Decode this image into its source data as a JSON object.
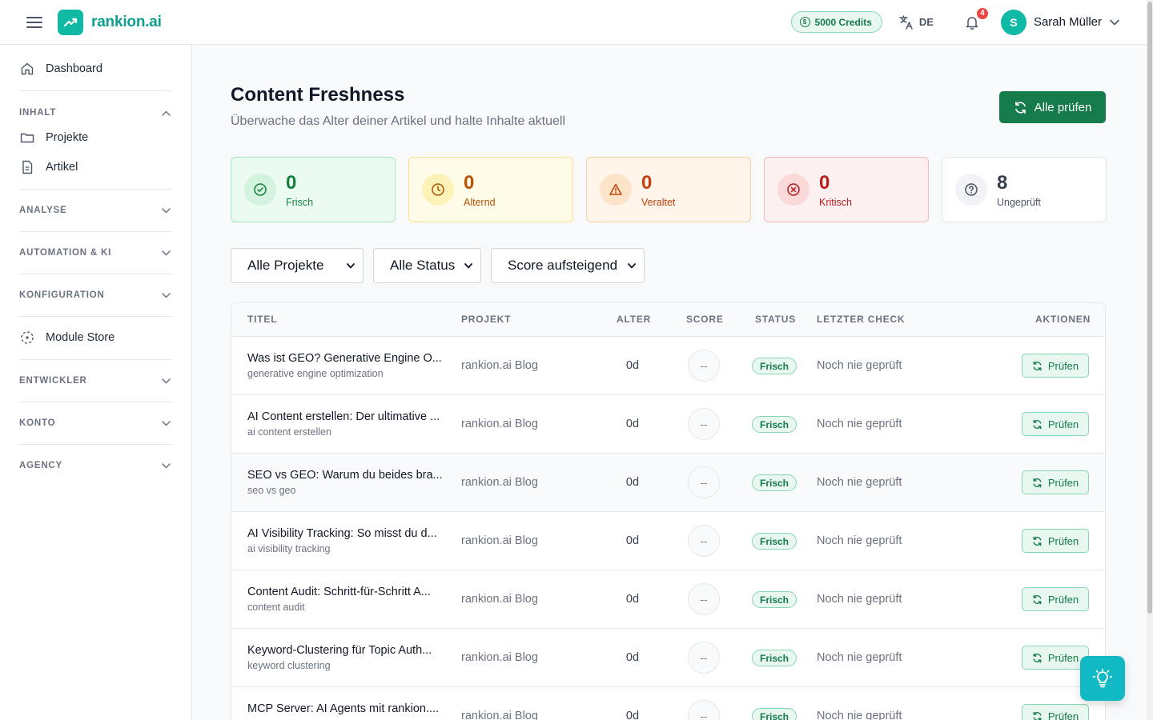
{
  "app": {
    "name": "rankion.ai"
  },
  "topbar": {
    "credits": "5000 Credits",
    "language": "DE",
    "notifications_count": "4",
    "user_initial": "S",
    "user_name": "Sarah Müller"
  },
  "sidebar": {
    "dashboard": "Dashboard",
    "inhalt": "INHALT",
    "projekte": "Projekte",
    "artikel": "Artikel",
    "analyse": "ANALYSE",
    "automation": "AUTOMATION & KI",
    "konfiguration": "KONFIGURATION",
    "module_store": "Module Store",
    "entwickler": "ENTWICKLER",
    "konto": "KONTO",
    "agency": "AGENCY"
  },
  "page": {
    "title": "Content Freshness",
    "subtitle": "Überwache das Alter deiner Artikel und halte Inhalte aktuell",
    "check_all_label": "Alle prüfen"
  },
  "stats": [
    {
      "value": "0",
      "label": "Frisch",
      "color": "#15803d"
    },
    {
      "value": "0",
      "label": "Alternd",
      "color": "#b45309"
    },
    {
      "value": "0",
      "label": "Veraltet",
      "color": "#c2410c"
    },
    {
      "value": "0",
      "label": "Kritisch",
      "color": "#b91c1c"
    },
    {
      "value": "8",
      "label": "Ungeprüft",
      "color": "#374151"
    }
  ],
  "filters": {
    "project": "Alle Projekte",
    "status": "Alle Status",
    "sort": "Score aufsteigend"
  },
  "table": {
    "headers": {
      "titel": "TITEL",
      "projekt": "PROJEKT",
      "alter": "ALTER",
      "score": "SCORE",
      "status": "STATUS",
      "letzter_check": "LETZTER CHECK",
      "aktionen": "AKTIONEN"
    },
    "action_label": "Prüfen",
    "rows": [
      {
        "title": "Was ist GEO? Generative Engine O...",
        "keyword": "generative engine optimization",
        "project": "rankion.ai Blog",
        "age": "0d",
        "score": "--",
        "status": "Frisch",
        "last_check": "Noch nie geprüft"
      },
      {
        "title": "AI Content erstellen: Der ultimative ...",
        "keyword": "ai content erstellen",
        "project": "rankion.ai Blog",
        "age": "0d",
        "score": "--",
        "status": "Frisch",
        "last_check": "Noch nie geprüft"
      },
      {
        "title": "SEO vs GEO: Warum du beides bra...",
        "keyword": "seo vs geo",
        "project": "rankion.ai Blog",
        "age": "0d",
        "score": "--",
        "status": "Frisch",
        "last_check": "Noch nie geprüft"
      },
      {
        "title": "AI Visibility Tracking: So misst du d...",
        "keyword": "ai visibility tracking",
        "project": "rankion.ai Blog",
        "age": "0d",
        "score": "--",
        "status": "Frisch",
        "last_check": "Noch nie geprüft"
      },
      {
        "title": "Content Audit: Schritt-für-Schritt A...",
        "keyword": "content audit",
        "project": "rankion.ai Blog",
        "age": "0d",
        "score": "--",
        "status": "Frisch",
        "last_check": "Noch nie geprüft"
      },
      {
        "title": "Keyword-Clustering für Topic Auth...",
        "keyword": "keyword clustering",
        "project": "rankion.ai Blog",
        "age": "0d",
        "score": "--",
        "status": "Frisch",
        "last_check": "Noch nie geprüft"
      },
      {
        "title": "MCP Server: AI Agents mit rankion....",
        "keyword": "",
        "project": "rankion.ai Blog",
        "age": "0d",
        "score": "--",
        "status": "Frisch",
        "last_check": "Noch nie geprüft"
      }
    ]
  }
}
